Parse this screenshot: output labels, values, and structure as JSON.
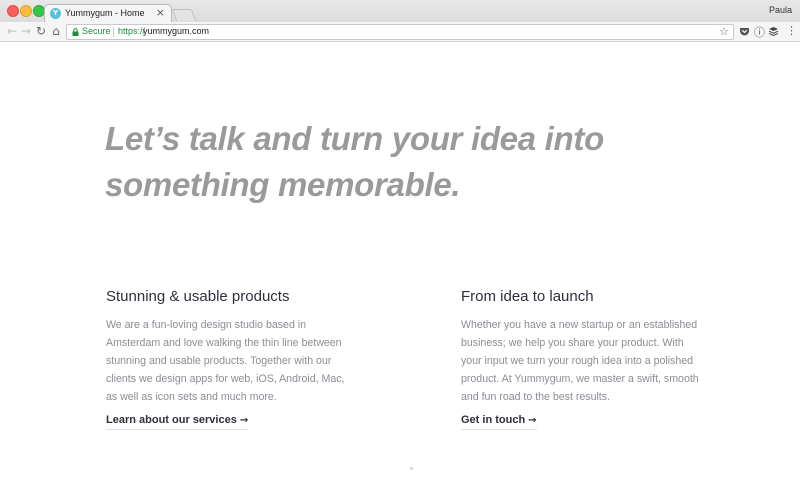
{
  "browser": {
    "tab": {
      "favicon_letter": "Y",
      "title": "Yummygum - Home",
      "close_glyph": "×"
    },
    "profile_name": "Paula",
    "nav": {
      "back_glyph": "←",
      "forward_glyph": "→",
      "reload_glyph": "↻",
      "home_glyph": "⌂"
    },
    "omnibox": {
      "secure_label": "Secure",
      "url_scheme": "https://",
      "url_host": "yummygum.com",
      "bookmark_glyph": "☆"
    },
    "extensions": [
      "pocket-icon",
      "info-icon",
      "buffer-icon",
      "menu-icon"
    ],
    "menu_glyph": "⋮",
    "info_glyph": "ⓘ"
  },
  "page": {
    "hero": {
      "line1": "Let’s talk and turn your idea into",
      "line2": "something memorable."
    },
    "columns": [
      {
        "heading": "Stunning & usable products",
        "body": "We are a fun-loving design studio based in Amsterdam and love walking the thin line between stunning and usable products. Together with our clients we design apps for web, iOS, Android, Mac, as well as icon sets and much more.",
        "cta": "Learn about our services",
        "cta_arrow": "→"
      },
      {
        "heading": "From idea to launch",
        "body": "Whether you have a new startup or an established business; we help you share your product. With your input we turn your rough idea into a polished product. At Yummygum, we master a swift, smooth and fun road to the best results.",
        "cta": "Get in touch",
        "cta_arrow": "→"
      }
    ]
  },
  "colors": {
    "hero_text": "#9a9a9c",
    "heading_text": "#2f2f3c",
    "body_text": "#8c8c94",
    "secure_green": "#1e8e3e"
  }
}
